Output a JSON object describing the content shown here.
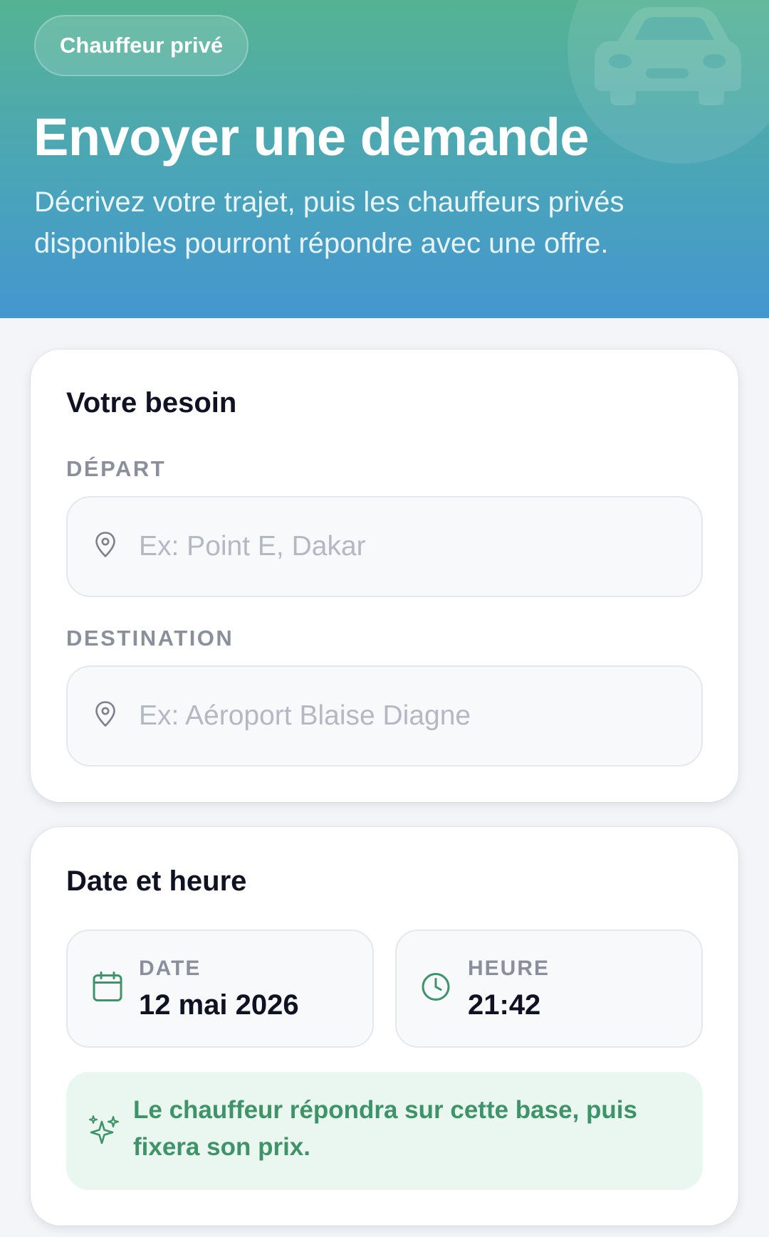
{
  "header": {
    "badge": "Chauffeur privé",
    "title": "Envoyer une demande",
    "subtitle": "Décrivez votre trajet, puis les chauffeurs privés disponibles pourront répondre avec une offre.",
    "decor_icon": "car-icon"
  },
  "need_section": {
    "title": "Votre besoin",
    "departure": {
      "label": "DÉPART",
      "value": "",
      "placeholder": "Ex: Point E, Dakar",
      "icon": "map-pin-icon"
    },
    "destination": {
      "label": "DESTINATION",
      "value": "",
      "placeholder": "Ex: Aéroport Blaise Diagne",
      "icon": "map-pin-icon"
    }
  },
  "datetime_section": {
    "title": "Date et heure",
    "date": {
      "label": "DATE",
      "value": "12 mai 2026",
      "icon": "calendar-icon"
    },
    "time": {
      "label": "HEURE",
      "value": "21:42",
      "icon": "clock-icon"
    },
    "info": {
      "text": "Le chauffeur répondra sur cette base, puis fixera son prix.",
      "icon": "sparkles-icon"
    }
  },
  "colors": {
    "hero_top": "#55b393",
    "hero_bottom": "#4496d0",
    "accent_green": "#3e9368",
    "info_bg": "#eaf6f0",
    "title_text": "#0f1222",
    "label_text": "#8a8f9c"
  }
}
